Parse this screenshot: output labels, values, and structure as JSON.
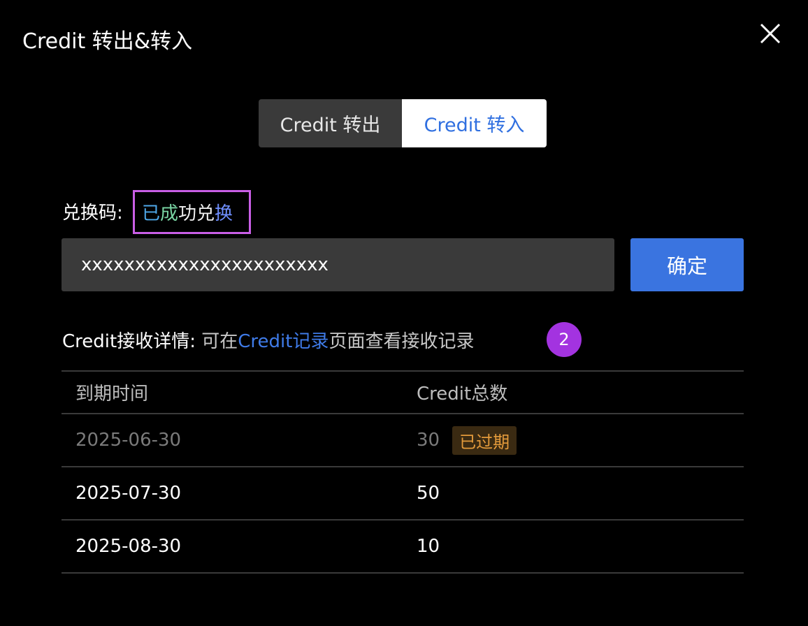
{
  "window": {
    "title": "Credit 转出&转入"
  },
  "tabs": {
    "out": "Credit 转出",
    "in": "Credit 转入"
  },
  "redeem": {
    "label": "兑换码:",
    "status": [
      "已",
      "成",
      "功兑",
      "换"
    ],
    "input_value": "xxxxxxxxxxxxxxxxxxxxxxx",
    "confirm_label": "确定"
  },
  "detail": {
    "label": "Credit接收详情:",
    "prefix": "可在",
    "link": "Credit记录",
    "suffix": "页面查看接收记录",
    "badge": "2"
  },
  "table": {
    "headers": [
      "到期时间",
      "Credit总数"
    ],
    "rows": [
      {
        "date": "2025-06-30",
        "total": "30",
        "tag": "已过期"
      },
      {
        "date": "2025-07-30",
        "total": "50"
      },
      {
        "date": "2025-08-30",
        "total": "10"
      }
    ]
  },
  "colors": {
    "accent": "#3a74e0",
    "link": "#3f7be8",
    "badge": "#a333e0",
    "highlight_border": "#c95ee6",
    "expired_tag": "#e39a3b"
  },
  "icons": {
    "close": "close-icon"
  }
}
